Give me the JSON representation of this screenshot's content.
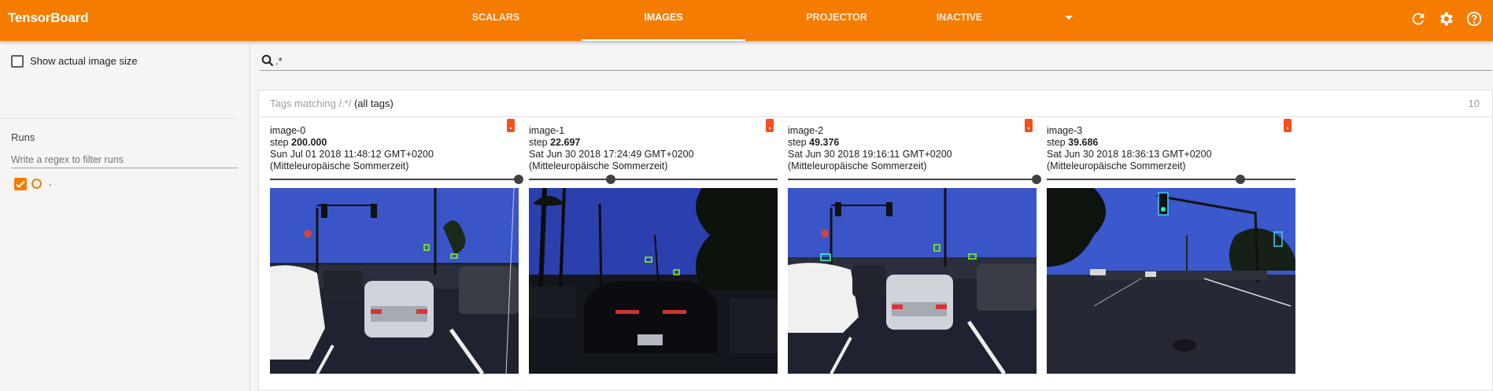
{
  "app": {
    "title": "TensorBoard"
  },
  "nav": {
    "tabs": [
      {
        "label": "Scalars"
      },
      {
        "label": "Images"
      },
      {
        "label": "Projector"
      },
      {
        "label": "Inactive"
      }
    ],
    "active_tab": "Images"
  },
  "header_icons": [
    "refresh-icon",
    "settings-icon",
    "help-icon"
  ],
  "sidebar": {
    "show_actual_size_label": "Show actual image size",
    "show_actual_size_checked": false,
    "runs_title": "Runs",
    "runs_filter_placeholder": "Write a regex to filter runs",
    "runs": [
      {
        "name": ".",
        "checked": true
      }
    ]
  },
  "search": {
    "value": ".*"
  },
  "tag_card": {
    "title_prefix": "Tags matching /.*/",
    "title_suffix": "(all tags)",
    "count": "10"
  },
  "images": [
    {
      "tag": "image-0",
      "step_label": "step",
      "step": "200.000",
      "time": "Sun Jul 01 2018 11:48:12 GMT+0200",
      "timezone": "(Mitteleuropäische Sommerzeit)",
      "slider_fraction": 1.0
    },
    {
      "tag": "image-1",
      "step_label": "step",
      "step": "22.697",
      "time": "Sat Jun 30 2018 17:24:49 GMT+0200",
      "timezone": "(Mitteleuropäische Sommerzeit)",
      "slider_fraction": 0.33
    },
    {
      "tag": "image-2",
      "step_label": "step",
      "step": "49.376",
      "time": "Sat Jun 30 2018 19:16:11 GMT+0200",
      "timezone": "(Mitteleuropäische Sommerzeit)",
      "slider_fraction": 1.0
    },
    {
      "tag": "image-3",
      "step_label": "step",
      "step": "39.686",
      "time": "Sat Jun 30 2018 18:36:13 GMT+0200",
      "timezone": "(Mitteleuropäische Sommerzeit)",
      "slider_fraction": 0.78
    }
  ],
  "colors": {
    "accent": "#f57c00",
    "run_color": "#f57c00",
    "flag": "#f4511e"
  }
}
